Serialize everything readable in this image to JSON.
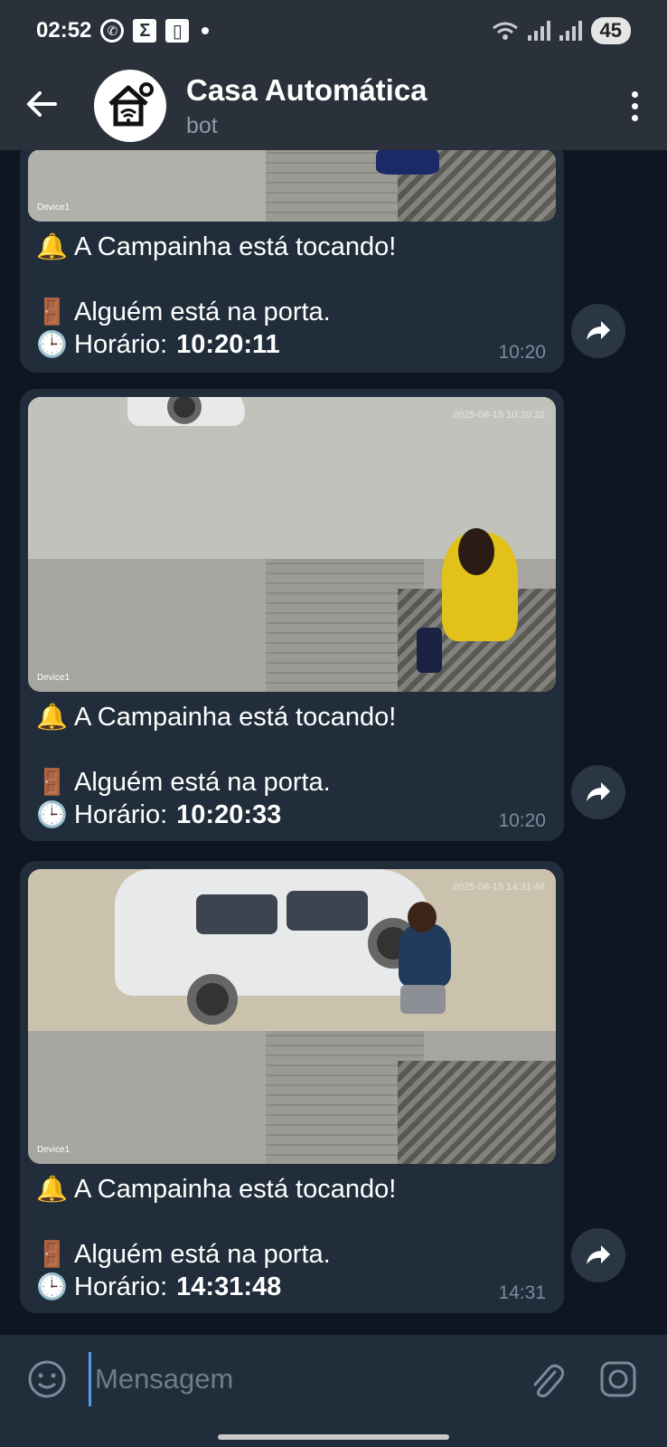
{
  "status_bar": {
    "time": "02:52",
    "battery": "45",
    "icons": [
      "whatsapp-icon",
      "sigma-icon",
      "sim-card-icon",
      "wifi-icon",
      "signal-icon"
    ]
  },
  "header": {
    "back_icon": "arrow-left-icon",
    "title": "Casa Automática",
    "subtitle": "bot",
    "menu_icon": "more-vertical-icon"
  },
  "messages": [
    {
      "line1_emoji": "🔔",
      "line1": "A Campainha está tocando!",
      "line2_emoji": "🚪",
      "line2": "Alguém está na porta.",
      "line3_emoji": "🕒",
      "line3_label": "Horário:",
      "line3_value": "10:20:11",
      "time": "10:20",
      "photo_label": "Device1"
    },
    {
      "line1_emoji": "🔔",
      "line1": "A Campainha está tocando!",
      "line2_emoji": "🚪",
      "line2": "Alguém está na porta.",
      "line3_emoji": "🕒",
      "line3_label": "Horário:",
      "line3_value": "10:20:33",
      "time": "10:20",
      "photo_label": "Device1",
      "photo_stamp": "2025-08-15 10:20:32"
    },
    {
      "line1_emoji": "🔔",
      "line1": "A Campainha está tocando!",
      "line2_emoji": "🚪",
      "line2": "Alguém está na porta.",
      "line3_emoji": "🕒",
      "line3_label": "Horário:",
      "line3_value": "14:31:48",
      "time": "14:31",
      "photo_label": "Device1",
      "photo_stamp": "2025-08-15 14:31:46"
    }
  ],
  "input_bar": {
    "placeholder": "Mensagem",
    "emoji_icon": "smiley-icon",
    "attach_icon": "paperclip-icon",
    "camera_icon": "instagram-camera-icon"
  },
  "colors": {
    "header_bg": "#2a313b",
    "chat_bg": "#0e1621",
    "bubble_bg": "#212d3b",
    "time_color": "#7c8a99",
    "accent": "#4f9fe9"
  }
}
